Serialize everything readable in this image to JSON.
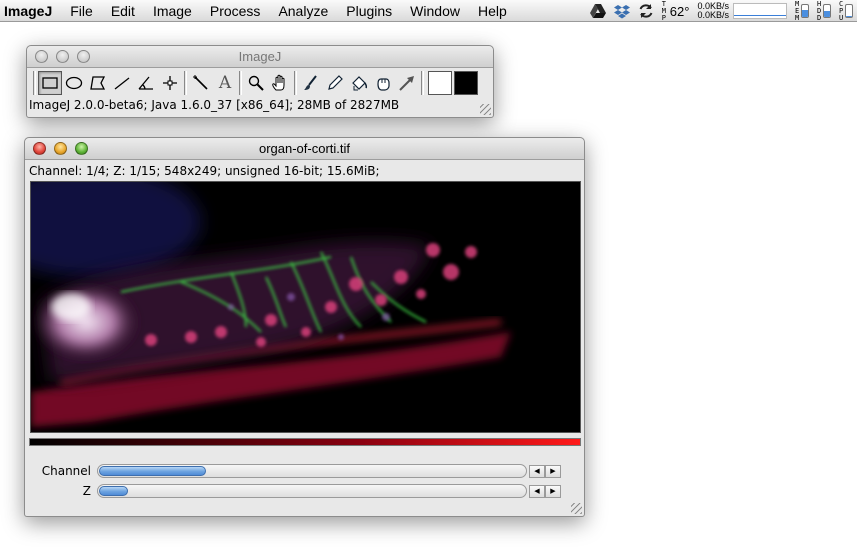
{
  "menubar": {
    "app_name": "ImageJ",
    "items": [
      "File",
      "Edit",
      "Image",
      "Process",
      "Analyze",
      "Plugins",
      "Window",
      "Help"
    ]
  },
  "status_area": {
    "temp_label": "TMP",
    "temperature": "62°",
    "net_up": "0.0KB/s",
    "net_down": "0.0KB/s",
    "mem_label": "MEM",
    "hdd_label": "HDD",
    "cpu_label": "CPU",
    "mem_level": 0.55,
    "hdd_level": 0.5,
    "cpu_level": 0.05,
    "icons": [
      "google-drive-icon",
      "dropbox-icon",
      "sync-icon",
      "thermometer-icon"
    ]
  },
  "toolbar_window": {
    "title": "ImageJ",
    "tools": [
      {
        "name": "rectangle-tool",
        "icon": "rectangle-icon"
      },
      {
        "name": "oval-tool",
        "icon": "oval-icon"
      },
      {
        "name": "polygon-tool",
        "icon": "polygon-icon"
      },
      {
        "name": "line-tool",
        "icon": "line-icon"
      },
      {
        "name": "angle-tool",
        "icon": "angle-icon"
      },
      {
        "name": "point-tool",
        "icon": "crosshair-icon"
      },
      {
        "name": "wand-tool",
        "icon": "wand-icon"
      },
      {
        "name": "text-tool",
        "icon": "text-icon",
        "glyph": "A"
      },
      {
        "name": "magnifier-tool",
        "icon": "magnifier-icon"
      },
      {
        "name": "hand-tool",
        "icon": "hand-icon"
      },
      {
        "name": "brush-tool",
        "icon": "brush-icon"
      },
      {
        "name": "pencil-tool",
        "icon": "pencil-icon"
      },
      {
        "name": "flood-tool",
        "icon": "flood-icon"
      },
      {
        "name": "grab-tool",
        "icon": "grab-icon"
      },
      {
        "name": "arrow-tool",
        "icon": "arrow-icon"
      }
    ],
    "foreground_color": "#ffffff",
    "background_color": "#000000",
    "status": "ImageJ 2.0.0-beta6; Java 1.6.0_37 [x86_64]; 28MB of 2827MB"
  },
  "image_window": {
    "title": "organ-of-corti.tif",
    "info": "Channel: 1/4; Z: 1/15; 548x249; unsigned 16-bit; 15.6MiB;",
    "sliders": [
      {
        "label": "Channel",
        "value": 1,
        "max": 4
      },
      {
        "label": "Z",
        "value": 1,
        "max": 15
      }
    ],
    "lut_color": "#ff1a1a"
  }
}
